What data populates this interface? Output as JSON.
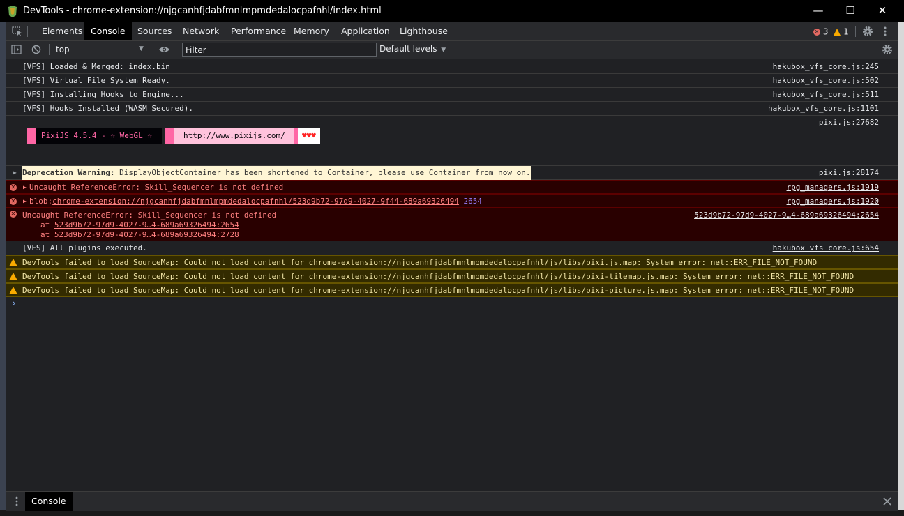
{
  "window": {
    "title": "DevTools - chrome-extension://njgcanhfjdabfmnlmpmdedalocpafnhl/index.html",
    "minimize_glyph": "—",
    "maximize_glyph": "☐",
    "close_glyph": "✕"
  },
  "tabs": [
    {
      "label": "Elements"
    },
    {
      "label": "Console"
    },
    {
      "label": "Sources"
    },
    {
      "label": "Network"
    },
    {
      "label": "Performance"
    },
    {
      "label": "Memory"
    },
    {
      "label": "Application"
    },
    {
      "label": "Lighthouse"
    }
  ],
  "issues": {
    "errors": "3",
    "warnings": "1"
  },
  "toolbar": {
    "context": "top",
    "filter_placeholder": "Filter",
    "levels": "Default levels"
  },
  "messages": {
    "m1": {
      "text": "[VFS] Loaded & Merged: index.bin",
      "src": "hakubox_vfs_core.js:245"
    },
    "m2": {
      "text": "[VFS] Virtual File System Ready.",
      "src": "hakubox_vfs_core.js:502"
    },
    "m3": {
      "text": "[VFS] Installing Hooks to Engine...",
      "src": "hakubox_vfs_core.js:511"
    },
    "m4": {
      "text": "[VFS] Hooks Installed (WASM Secured).",
      "src": "hakubox_vfs_core.js:1101"
    },
    "pixi": {
      "src": "pixi.js:27682",
      "banner": "PixiJS 4.5.4 - ☆ WebGL ☆",
      "url": "http://www.pixijs.com/",
      "hearts": "♥♥♥"
    },
    "deprecation": {
      "label": "Deprecation Warning:",
      "text": "DisplayObjectContainer has been shortened to Container, please use Container from now on.",
      "src": "pixi.js:28174"
    },
    "err1": {
      "text": "Uncaught ReferenceError: Skill_Sequencer is not defined",
      "src": "rpg_managers.js:1919"
    },
    "err2": {
      "prefix": "blob:",
      "link": "chrome-extension://njgcanhfjdabfmnlmpmdedalocpafnhl/523d9b72-97d9-4027-9f44-689a69326494",
      "line": "2654",
      "src": "rpg_managers.js:1920"
    },
    "err3": {
      "text": "Uncaught ReferenceError: Skill_Sequencer is not defined",
      "src": "523d9b72-97d9-4027-9…4-689a69326494:2654",
      "at1": "523d9b72-97d9-4027-9…4-689a69326494:2654",
      "at2": "523d9b72-97d9-4027-9…4-689a69326494:2728",
      "at_label": "at"
    },
    "m5": {
      "text": "[VFS] All plugins executed.",
      "src": "hakubox_vfs_core.js:654"
    },
    "w1": {
      "pre": "DevTools failed to load SourceMap: Could not load content for",
      "link": "chrome-extension://njgcanhfjdabfmnlmpmdedalocpafnhl/js/libs/pixi.js.map",
      "post": ": System error: net::ERR_FILE_NOT_FOUND"
    },
    "w2": {
      "pre": "DevTools failed to load SourceMap: Could not load content for",
      "link": "chrome-extension://njgcanhfjdabfmnlmpmdedalocpafnhl/js/libs/pixi-tilemap.js.map",
      "post": ": System error: net::ERR_FILE_NOT_FOUND"
    },
    "w3": {
      "pre": "DevTools failed to load SourceMap: Could not load content for",
      "link": "chrome-extension://njgcanhfjdabfmnlmpmdedalocpafnhl/js/libs/pixi-picture.js.map",
      "post": ": System error: net::ERR_FILE_NOT_FOUND"
    }
  },
  "prompt": "›",
  "drawer": {
    "tab": "Console"
  },
  "colors": {
    "error": "#e46962",
    "warning": "#f9ab00",
    "accent": "#8ab4f8",
    "pink": "#ff66a5"
  }
}
